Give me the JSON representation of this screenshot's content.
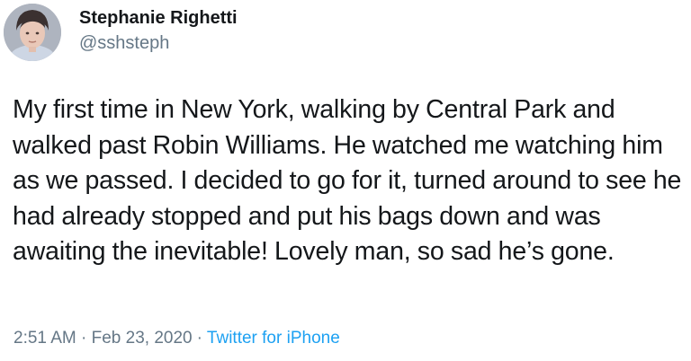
{
  "tweet": {
    "author": {
      "display_name": "Stephanie Righetti",
      "handle": "@sshsteph",
      "avatar_icon": "user-avatar-photo"
    },
    "text": "My first time in New York, walking by Central Park and walked past Robin Williams. He watched me watching him as we passed. I decided to go for it, turned around to see he had already stopped and put his bags down and was awaiting the inevitable! Lovely man, so sad he’s gone.",
    "time": "2:51 AM",
    "separator": "·",
    "date": "Feb 23, 2020",
    "source": "Twitter for iPhone"
  },
  "colors": {
    "text_primary": "#14171a",
    "text_secondary": "#657786",
    "link": "#1da1f2",
    "background": "#ffffff"
  }
}
